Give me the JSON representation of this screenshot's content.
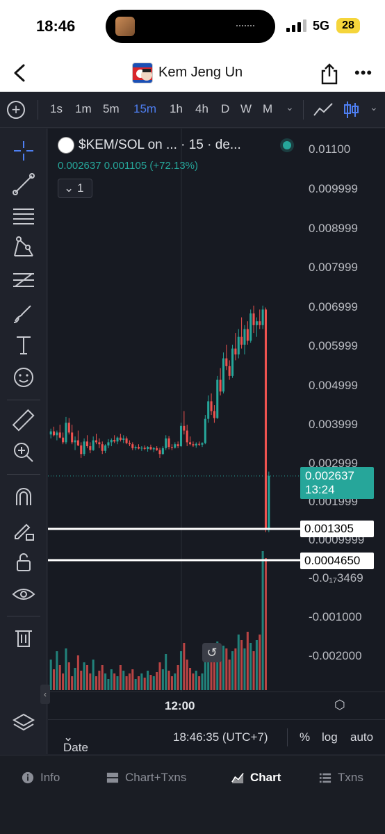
{
  "status_bar": {
    "time": "18:46",
    "network": "5G",
    "battery": "28"
  },
  "header": {
    "title": "Kem Jeng Un"
  },
  "timeframes": {
    "items": [
      "1s",
      "1m",
      "5m",
      "15m",
      "1h",
      "4h",
      "D",
      "W",
      "M"
    ],
    "active": "15m"
  },
  "legend": {
    "symbol": "$KEM/SOL on ... · 15 · de...",
    "values": "0.002637  0.001105 (+72.13%)",
    "collapse_label": "1"
  },
  "price_scale": {
    "ticks": [
      "0.01100",
      "0.009999",
      "0.008999",
      "0.007999",
      "0.006999",
      "0.005999",
      "0.004999",
      "0.003999",
      "0.002999",
      "0.001999",
      "0.0009999",
      "-0.0₁₇3469",
      "-0.001000",
      "-0.002000"
    ],
    "current_price": "0.002637",
    "countdown": "13:24",
    "levels": [
      "0.001305",
      "0.0004650"
    ]
  },
  "time_axis": {
    "label": "12:00"
  },
  "bottom_bar": {
    "date_range": "Date Range",
    "clock": "18:46:35 (UTC+7)",
    "percent": "%",
    "log": "log",
    "auto": "auto"
  },
  "tabs": [
    {
      "label": "Info",
      "icon": "info-icon"
    },
    {
      "label": "Chart+Txns",
      "icon": "split-icon"
    },
    {
      "label": "Chart",
      "icon": "chart-icon",
      "active": true
    },
    {
      "label": "Txns",
      "icon": "list-icon"
    }
  ],
  "colors": {
    "up": "#26a69a",
    "down": "#ef5350",
    "accent": "#4e7ff2"
  },
  "chart_data": {
    "type": "candlestick",
    "interval": "15m",
    "y_range": [
      -0.0025,
      0.0115
    ],
    "ohlc": [
      [
        0.0037,
        0.00385,
        0.0036,
        0.00378
      ],
      [
        0.00378,
        0.0039,
        0.00365,
        0.00368
      ],
      [
        0.00368,
        0.0038,
        0.00355,
        0.00375
      ],
      [
        0.00375,
        0.00395,
        0.0036,
        0.00362
      ],
      [
        0.00362,
        0.00375,
        0.00345,
        0.0035
      ],
      [
        0.0035,
        0.00415,
        0.00345,
        0.004
      ],
      [
        0.004,
        0.00412,
        0.0037,
        0.00375
      ],
      [
        0.00375,
        0.00395,
        0.00345,
        0.0035
      ],
      [
        0.0035,
        0.00365,
        0.0033,
        0.00355
      ],
      [
        0.00355,
        0.0038,
        0.0034,
        0.00342
      ],
      [
        0.00342,
        0.0035,
        0.0031,
        0.0032
      ],
      [
        0.0032,
        0.0036,
        0.00315,
        0.00352
      ],
      [
        0.00352,
        0.00368,
        0.00335,
        0.0034
      ],
      [
        0.0034,
        0.0035,
        0.00322,
        0.0033
      ],
      [
        0.0033,
        0.00365,
        0.00328,
        0.00355
      ],
      [
        0.00355,
        0.00372,
        0.00345,
        0.0035
      ],
      [
        0.0035,
        0.0036,
        0.00335,
        0.00345
      ],
      [
        0.00345,
        0.00352,
        0.0032,
        0.00328
      ],
      [
        0.00328,
        0.00345,
        0.00322,
        0.00342
      ],
      [
        0.00342,
        0.00358,
        0.00335,
        0.0035
      ],
      [
        0.0035,
        0.0036,
        0.0034,
        0.00356
      ],
      [
        0.00356,
        0.00368,
        0.00348,
        0.00352
      ],
      [
        0.00352,
        0.00365,
        0.00345,
        0.00362
      ],
      [
        0.00362,
        0.00372,
        0.00352,
        0.00356
      ],
      [
        0.00356,
        0.00368,
        0.00348,
        0.0036
      ],
      [
        0.0036,
        0.00365,
        0.00345,
        0.00348
      ],
      [
        0.00348,
        0.00355,
        0.0034,
        0.00345
      ],
      [
        0.00345,
        0.0035,
        0.0033,
        0.00335
      ],
      [
        0.00335,
        0.00342,
        0.0033,
        0.00338
      ],
      [
        0.00338,
        0.00345,
        0.00332,
        0.00334
      ],
      [
        0.00334,
        0.0034,
        0.00328,
        0.00336
      ],
      [
        0.00336,
        0.00342,
        0.0033,
        0.00333
      ],
      [
        0.00333,
        0.0034,
        0.00326,
        0.00338
      ],
      [
        0.00338,
        0.00344,
        0.0033,
        0.00332
      ],
      [
        0.00332,
        0.00338,
        0.00325,
        0.00335
      ],
      [
        0.00335,
        0.0034,
        0.00328,
        0.0033
      ],
      [
        0.0033,
        0.00336,
        0.0031,
        0.0032
      ],
      [
        0.0032,
        0.0034,
        0.00318,
        0.00335
      ],
      [
        0.00335,
        0.00368,
        0.0033,
        0.0036
      ],
      [
        0.0036,
        0.00366,
        0.00332,
        0.00338
      ],
      [
        0.00338,
        0.00345,
        0.0033,
        0.00336
      ],
      [
        0.00336,
        0.0035,
        0.00334,
        0.00345
      ],
      [
        0.00345,
        0.00352,
        0.00335,
        0.0034
      ],
      [
        0.0034,
        0.004,
        0.00338,
        0.00392
      ],
      [
        0.00392,
        0.0043,
        0.0037,
        0.0038
      ],
      [
        0.0038,
        0.00395,
        0.0034,
        0.0035
      ],
      [
        0.0035,
        0.00365,
        0.00342,
        0.00345
      ],
      [
        0.00345,
        0.00352,
        0.00338,
        0.00342
      ],
      [
        0.00342,
        0.0035,
        0.00336,
        0.00346
      ],
      [
        0.00346,
        0.00352,
        0.0034,
        0.00344
      ],
      [
        0.00344,
        0.0035,
        0.00338,
        0.00348
      ],
      [
        0.00348,
        0.0042,
        0.00345,
        0.0041
      ],
      [
        0.0041,
        0.0047,
        0.004,
        0.00455
      ],
      [
        0.00455,
        0.00475,
        0.0042,
        0.0043
      ],
      [
        0.0043,
        0.00445,
        0.004,
        0.00412
      ],
      [
        0.00412,
        0.0052,
        0.0041,
        0.0051
      ],
      [
        0.0051,
        0.0054,
        0.0047,
        0.0048
      ],
      [
        0.0048,
        0.0058,
        0.00475,
        0.00565
      ],
      [
        0.00565,
        0.006,
        0.00535,
        0.00545
      ],
      [
        0.00545,
        0.0056,
        0.0051,
        0.0052
      ],
      [
        0.0052,
        0.006,
        0.00515,
        0.0059
      ],
      [
        0.0059,
        0.0063,
        0.0056,
        0.00575
      ],
      [
        0.00575,
        0.0064,
        0.00565,
        0.0062
      ],
      [
        0.0062,
        0.0067,
        0.0059,
        0.006
      ],
      [
        0.006,
        0.0065,
        0.00575,
        0.0064
      ],
      [
        0.0064,
        0.0066,
        0.006,
        0.0061
      ],
      [
        0.0061,
        0.0069,
        0.00605,
        0.0068
      ],
      [
        0.0068,
        0.007,
        0.0063,
        0.0065
      ],
      [
        0.0065,
        0.0067,
        0.0062,
        0.0066
      ],
      [
        0.0066,
        0.0069,
        0.0064,
        0.0065
      ],
      [
        0.0065,
        0.007,
        0.0064,
        0.0069
      ],
      [
        0.0069,
        0.00695,
        0.0012,
        0.0013
      ],
      [
        0.0013,
        0.00275,
        0.0012,
        0.00264
      ]
    ],
    "volume": [
      0.22,
      0.15,
      0.28,
      0.18,
      0.12,
      0.3,
      0.2,
      0.1,
      0.16,
      0.25,
      0.14,
      0.2,
      0.18,
      0.12,
      0.22,
      0.1,
      0.14,
      0.18,
      0.12,
      0.08,
      0.15,
      0.12,
      0.1,
      0.18,
      0.14,
      0.1,
      0.12,
      0.15,
      0.08,
      0.1,
      0.12,
      0.09,
      0.14,
      0.11,
      0.1,
      0.13,
      0.2,
      0.15,
      0.26,
      0.14,
      0.1,
      0.12,
      0.18,
      0.28,
      0.34,
      0.22,
      0.16,
      0.12,
      0.14,
      0.1,
      0.12,
      0.3,
      0.26,
      0.2,
      0.22,
      0.35,
      0.24,
      0.32,
      0.3,
      0.22,
      0.28,
      0.3,
      0.4,
      0.36,
      0.3,
      0.42,
      0.34,
      0.28,
      0.36,
      0.4,
      1.0,
      0.95
    ]
  }
}
